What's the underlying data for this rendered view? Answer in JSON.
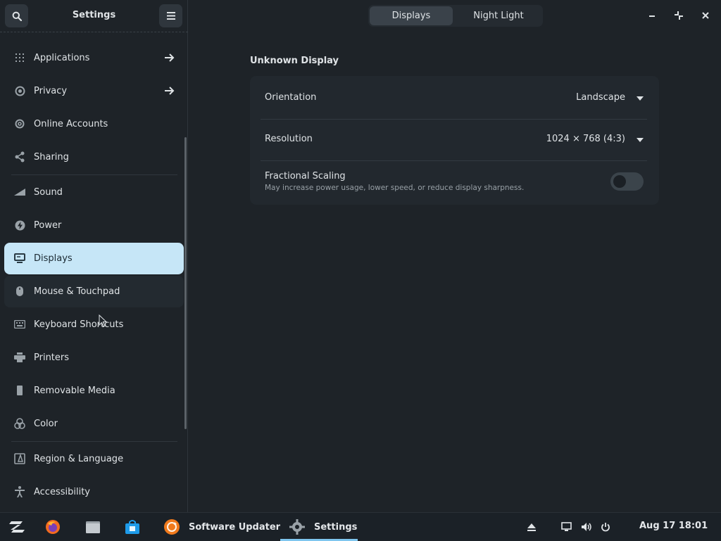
{
  "sidebar": {
    "title": "Settings",
    "items": [
      {
        "label": "Applications",
        "icon": "grid-icon",
        "arrow": true
      },
      {
        "label": "Privacy",
        "icon": "privacy-icon",
        "arrow": true
      },
      {
        "label": "Online Accounts",
        "icon": "at-icon",
        "arrow": false
      },
      {
        "label": "Sharing",
        "icon": "share-icon",
        "arrow": false
      },
      {
        "label": "Sound",
        "icon": "sound-icon",
        "arrow": false
      },
      {
        "label": "Power",
        "icon": "power-bolt-icon",
        "arrow": false
      },
      {
        "label": "Displays",
        "icon": "display-icon",
        "arrow": false,
        "active": true
      },
      {
        "label": "Mouse & Touchpad",
        "icon": "mouse-icon",
        "arrow": false
      },
      {
        "label": "Keyboard Shortcuts",
        "icon": "keyboard-icon",
        "arrow": false
      },
      {
        "label": "Printers",
        "icon": "printer-icon",
        "arrow": false
      },
      {
        "label": "Removable Media",
        "icon": "usb-icon",
        "arrow": false
      },
      {
        "label": "Color",
        "icon": "color-icon",
        "arrow": false
      },
      {
        "label": "Region & Language",
        "icon": "region-icon",
        "arrow": false
      },
      {
        "label": "Accessibility",
        "icon": "accessibility-icon",
        "arrow": false
      }
    ]
  },
  "tabs": [
    {
      "label": "Displays",
      "active": true
    },
    {
      "label": "Night Light",
      "active": false
    }
  ],
  "display": {
    "title": "Unknown Display",
    "orientation_label": "Orientation",
    "orientation_value": "Landscape",
    "resolution_label": "Resolution",
    "resolution_value": "1024 × 768 (4:3)",
    "scaling_label": "Fractional Scaling",
    "scaling_sub": "May increase power usage, lower speed, or reduce display sharpness.",
    "scaling_enabled": false
  },
  "taskbar": {
    "apps": [
      {
        "label": "Software Updater",
        "icon": "updater-icon"
      },
      {
        "label": "Settings",
        "icon": "settings-gear-icon",
        "active": true
      }
    ],
    "clock": "Aug 17  18:01"
  },
  "colors": {
    "accent": "#c6e6f7",
    "background": "#1e2328",
    "card": "#22282e",
    "taskbar_indicator": "#7fc6ef"
  }
}
